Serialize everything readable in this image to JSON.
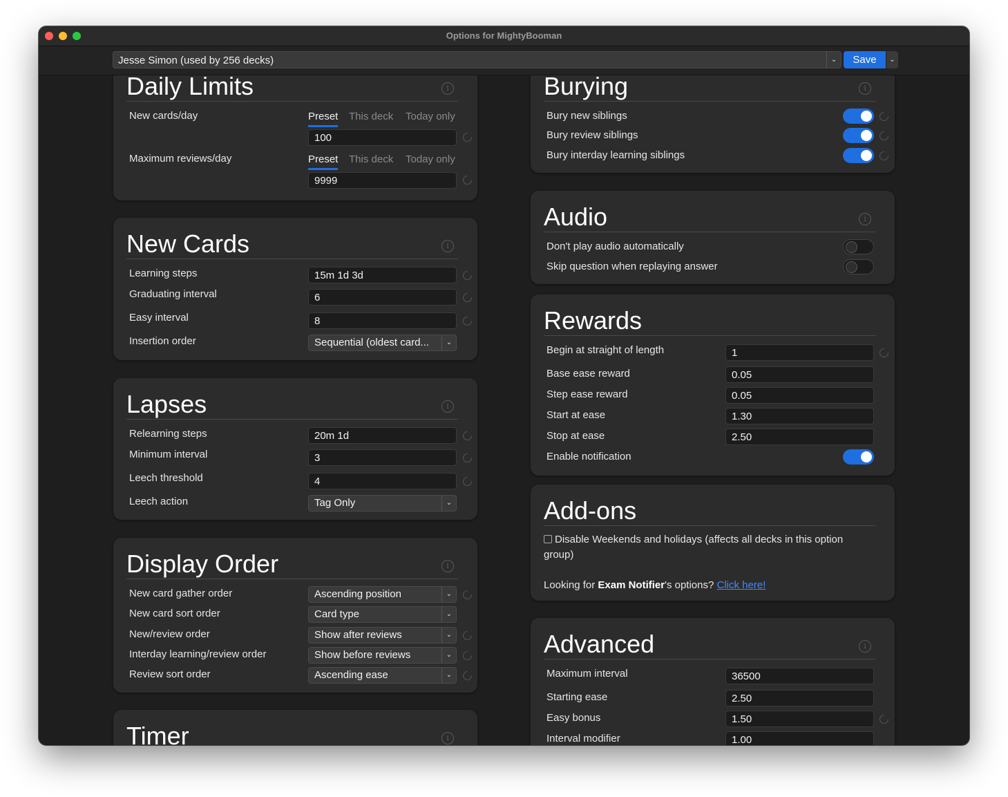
{
  "window": {
    "title": "Options for MightyBooman"
  },
  "topbar": {
    "preset": "Jesse Simon (used by 256 decks)",
    "save_label": "Save"
  },
  "tabs": {
    "preset": "Preset",
    "this_deck": "This deck",
    "today_only": "Today only"
  },
  "daily_limits": {
    "title": "Daily Limits",
    "new_cards_label": "New cards/day",
    "new_cards_value": "100",
    "max_reviews_label": "Maximum reviews/day",
    "max_reviews_value": "9999"
  },
  "new_cards": {
    "title": "New Cards",
    "learning_steps_label": "Learning steps",
    "learning_steps_value": "15m 1d 3d",
    "graduating_label": "Graduating interval",
    "graduating_value": "6",
    "easy_label": "Easy interval",
    "easy_value": "8",
    "insertion_label": "Insertion order",
    "insertion_value": "Sequential (oldest card..."
  },
  "lapses": {
    "title": "Lapses",
    "relearning_label": "Relearning steps",
    "relearning_value": "20m 1d",
    "min_interval_label": "Minimum interval",
    "min_interval_value": "3",
    "leech_threshold_label": "Leech threshold",
    "leech_threshold_value": "4",
    "leech_action_label": "Leech action",
    "leech_action_value": "Tag Only"
  },
  "display_order": {
    "title": "Display Order",
    "gather_label": "New card gather order",
    "gather_value": "Ascending position",
    "sort_label": "New card sort order",
    "sort_value": "Card type",
    "new_review_label": "New/review order",
    "new_review_value": "Show after reviews",
    "interday_label": "Interday learning/review order",
    "interday_value": "Show before reviews",
    "review_sort_label": "Review sort order",
    "review_sort_value": "Ascending ease"
  },
  "timer": {
    "title": "Timer"
  },
  "burying": {
    "title": "Burying",
    "new_siblings": "Bury new siblings",
    "review_siblings": "Bury review siblings",
    "interday_siblings": "Bury interday learning siblings"
  },
  "audio": {
    "title": "Audio",
    "no_autoplay": "Don't play audio automatically",
    "skip_question": "Skip question when replaying answer"
  },
  "rewards": {
    "title": "Rewards",
    "straight_label": "Begin at straight of length",
    "straight_value": "1",
    "base_label": "Base ease reward",
    "base_value": "0.05",
    "step_label": "Step ease reward",
    "step_value": "0.05",
    "start_label": "Start at ease",
    "start_value": "1.30",
    "stop_label": "Stop at ease",
    "stop_value": "2.50",
    "notify_label": "Enable notification"
  },
  "addons": {
    "title": "Add-ons",
    "weekends_line1": "Disable Weekends and holidays (affects all decks in this option",
    "weekends_line2": "group)",
    "looking_prefix": "Looking for ",
    "addon_name": "Exam Notifier",
    "looking_suffix": "'s options? ",
    "link": "Click here!"
  },
  "advanced": {
    "title": "Advanced",
    "max_interval_label": "Maximum interval",
    "max_interval_value": "36500",
    "starting_ease_label": "Starting ease",
    "starting_ease_value": "2.50",
    "easy_bonus_label": "Easy bonus",
    "easy_bonus_value": "1.50",
    "interval_mod_label": "Interval modifier",
    "interval_mod_value": "1.00"
  },
  "colors": {
    "accent": "#1f6fe0",
    "background": "#1e1e1e",
    "card": "#2c2c2c"
  }
}
